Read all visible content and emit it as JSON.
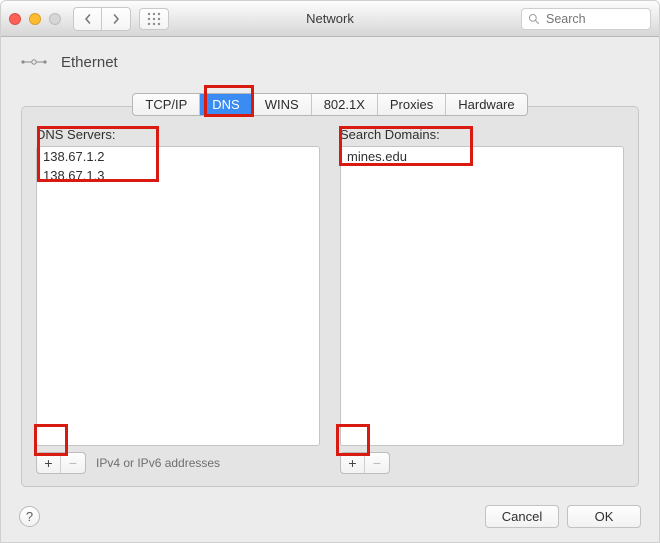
{
  "window": {
    "title": "Network"
  },
  "search": {
    "placeholder": "Search"
  },
  "pane": {
    "title": "Ethernet"
  },
  "tabs": {
    "items": [
      "TCP/IP",
      "DNS",
      "WINS",
      "802.1X",
      "Proxies",
      "Hardware"
    ],
    "selected_index": 1
  },
  "columns": {
    "dns": {
      "label": "DNS Servers:",
      "items": [
        "138.67.1.2",
        "138.67.1.3"
      ],
      "hint": "IPv4 or IPv6 addresses"
    },
    "domains": {
      "label": "Search Domains:",
      "items": [
        "mines.edu"
      ]
    }
  },
  "buttons": {
    "plus": "+",
    "minus": "−",
    "help": "?",
    "cancel": "Cancel",
    "ok": "OK"
  }
}
